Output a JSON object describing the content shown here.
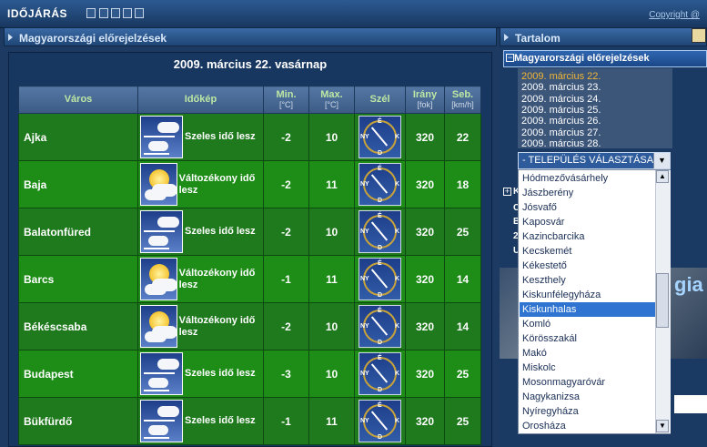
{
  "window": {
    "title": "IDŐJÁRÁS",
    "copyright": "Copyright @"
  },
  "main_panel": {
    "title": "Magyarországi előrejelzések",
    "date": "2009. március 22. vasárnap",
    "columns": [
      {
        "label": "Város",
        "unit": ""
      },
      {
        "label": "Időkép",
        "unit": ""
      },
      {
        "label": "Min.",
        "unit": "[°C]"
      },
      {
        "label": "Max.",
        "unit": "[°C]"
      },
      {
        "label": "Szél",
        "unit": ""
      },
      {
        "label": "Irány",
        "unit": "[fok]"
      },
      {
        "label": "Seb.",
        "unit": "[km/h]"
      }
    ],
    "rows": [
      {
        "city": "Ajka",
        "icon": "windy-cloud-icon",
        "desc": "Szeles idő lesz",
        "min": "-2",
        "max": "10",
        "dir": "320",
        "speed": "22"
      },
      {
        "city": "Baja",
        "icon": "sun-cloud-icon",
        "desc": "Változékony idő lesz",
        "min": "-2",
        "max": "11",
        "dir": "320",
        "speed": "18"
      },
      {
        "city": "Balatonfüred",
        "icon": "windy-cloud-icon",
        "desc": "Szeles idő lesz",
        "min": "-2",
        "max": "10",
        "dir": "320",
        "speed": "25"
      },
      {
        "city": "Barcs",
        "icon": "sun-cloud-icon",
        "desc": "Változékony idő lesz",
        "min": "-1",
        "max": "11",
        "dir": "320",
        "speed": "14"
      },
      {
        "city": "Békéscsaba",
        "icon": "sun-cloud-icon",
        "desc": "Változékony idő lesz",
        "min": "-2",
        "max": "10",
        "dir": "320",
        "speed": "14"
      },
      {
        "city": "Budapest",
        "icon": "windy-cloud-icon",
        "desc": "Szeles idő lesz",
        "min": "-3",
        "max": "10",
        "dir": "320",
        "speed": "25"
      },
      {
        "city": "Bükfürdő",
        "icon": "windy-cloud-icon",
        "desc": "Szeles idő lesz",
        "min": "-1",
        "max": "11",
        "dir": "320",
        "speed": "25"
      }
    ],
    "compass_labels": {
      "n": "É",
      "s": "D",
      "e": "K",
      "w": "NY"
    }
  },
  "side_panel": {
    "title": "Tartalom",
    "section_title": "Magyarországi előrejelzések",
    "dates": [
      {
        "label": "2009. március 22.",
        "active": true
      },
      {
        "label": "2009. március 23.",
        "active": false
      },
      {
        "label": "2009. március 24.",
        "active": false
      },
      {
        "label": "2009. március 25.",
        "active": false
      },
      {
        "label": "2009. március 26.",
        "active": false
      },
      {
        "label": "2009. március 27.",
        "active": false
      },
      {
        "label": "2009. március 28.",
        "active": false
      }
    ],
    "select": {
      "value": "- TELEPÜLÉS VÁLASZTÁSA-",
      "options": [
        "Hódmezővásárhely",
        "Jászberény",
        "Jósvafő",
        "Kaposvár",
        "Kazincbarcika",
        "Kecskemét",
        "Kékestető",
        "Keszthely",
        "Kiskunfélegyháza",
        "Kiskunhalas",
        "Komló",
        "Körösszakál",
        "Makó",
        "Miskolc",
        "Mosonmagyaróvár",
        "Nagykanizsa",
        "Nyíregyháza",
        "Orosháza"
      ],
      "selected": "Kiskunhalas"
    },
    "behind_text": [
      "K",
      "C",
      "B",
      "2",
      "U"
    ],
    "photo_text": "gia"
  }
}
